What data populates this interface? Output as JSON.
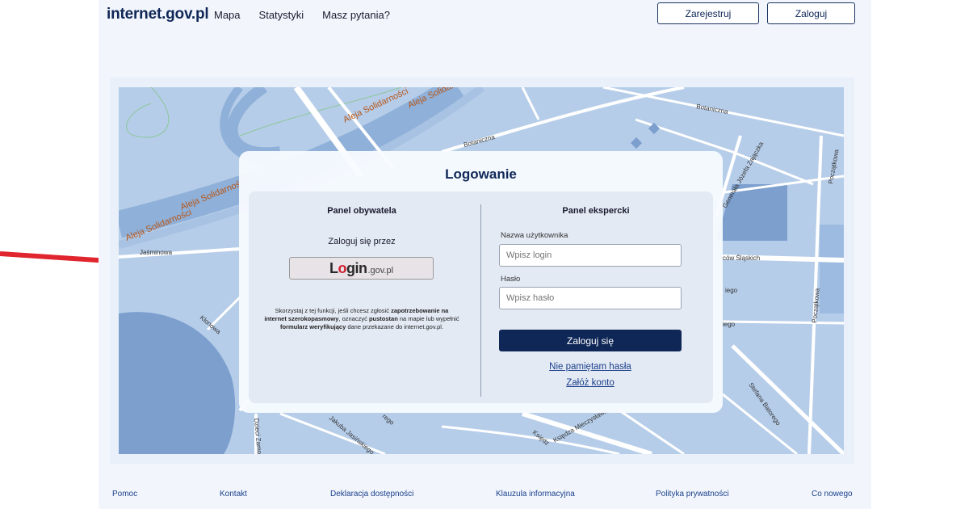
{
  "header": {
    "logo": "internet.gov.pl",
    "nav": [
      "Mapa",
      "Statystyki",
      "Masz pytania?"
    ],
    "register_label": "Zarejestruj",
    "login_label": "Zaloguj"
  },
  "map": {
    "streets": [
      "Aleja Solidarności",
      "Aleja Solidarności",
      "Aleja Solidarności",
      "Aleja Solidarności",
      "Botaniczna",
      "Botaniczna",
      "Jaśminowa",
      "Kłonowa",
      "Generała Józefa Zajączka",
      "Początkowa",
      "Początkowa",
      "ców Śląskich",
      "iego",
      "Stefana Batorego",
      "Dzieci Zamo",
      "Jakuba Jasińskiego",
      "Księdza Mieczysława",
      "Księdz",
      "rego",
      "iego"
    ],
    "colors": {
      "water": "#7d9fce",
      "land": "#b6cde9",
      "road": "#ffffff",
      "highway": "#8fb0d8"
    }
  },
  "login": {
    "title": "Logowanie",
    "citizen": {
      "title": "Panel obywatela",
      "via_label": "Zaloguj się przez",
      "provider_main_pre": "L",
      "provider_main_o": "o",
      "provider_main_post": "gin",
      "provider_suffix": ".gov.pl",
      "info": {
        "t1": "Skorzystaj z tej funkcji, jeśli chcesz zgłosić ",
        "b1": "zapotrzebowanie na internet szerokopasmowy",
        "t2": ", oznaczyć ",
        "b2": "pustostan",
        "t3": " na mapie lub wypełnić ",
        "b3": "formularz weryfikujący",
        "t4": " dane przekazane do internet.gov.pl."
      }
    },
    "expert": {
      "title": "Panel ekspercki",
      "username_label": "Nazwa użytkownika",
      "username_placeholder": "Wpisz login",
      "password_label": "Hasło",
      "password_placeholder": "Wpisz hasło",
      "submit_label": "Zaloguj się",
      "forgot_label": "Nie pamiętam hasła",
      "create_label": "Załóż konto"
    }
  },
  "footer": [
    "Pomoc",
    "Kontakt",
    "Deklaracja dostępności",
    "Klauzula informacyjna",
    "Polityka prywatności",
    "Co nowego"
  ],
  "accent": {
    "navy": "#0f2757",
    "arrow_red": "#e1252f"
  }
}
